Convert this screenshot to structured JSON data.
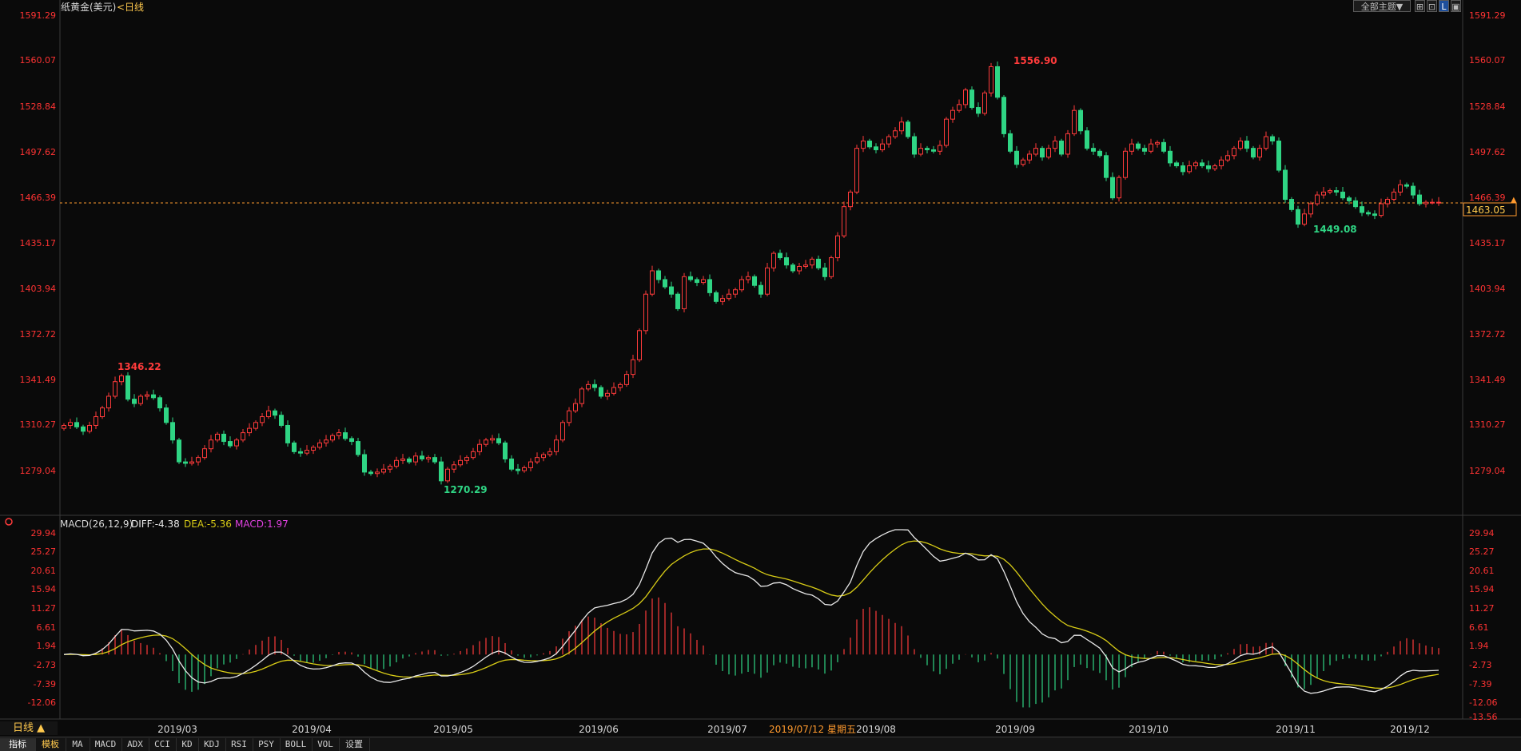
{
  "header": {
    "title": "纸黄金(美元)",
    "period": "<日线",
    "theme_button": "全部主题▼"
  },
  "price": {
    "current_label": "1463.05",
    "high_label": "1556.90",
    "low_label": "1270.29",
    "local_high_label": "1346.22",
    "recent_low_label": "1449.08"
  },
  "indicator": {
    "name": "MACD(26,12,9)",
    "diff_label": "DIFF:-4.38",
    "dea_label": "DEA:-5.36",
    "macd_label": "MACD:1.97"
  },
  "colors": {
    "up": "#ff3b3b",
    "down": "#2fd584",
    "axis_label": "#ff3333",
    "diff_line": "#e8e8e8",
    "dea_line": "#d8cc16",
    "macd_text": "#e040e0",
    "current_line": "#ff9a2e"
  },
  "xaxis": {
    "labels": [
      "2019/03",
      "2019/04",
      "2019/05",
      "2019/06",
      "2019/07",
      "2019/08",
      "2019/09",
      "2019/10",
      "2019/11",
      "2019/12"
    ],
    "cursor_date": "2019/07/12 星期五"
  },
  "bottom": {
    "period_tab": "日线 ▲",
    "tabs": [
      "指标",
      "模板",
      "MA",
      "MACD",
      "ADX",
      "CCI",
      "KD",
      "KDJ",
      "RSI",
      "PSY",
      "BOLL",
      "VOL",
      "设置"
    ]
  },
  "chart_data": [
    {
      "type": "candlestick",
      "title": "纸黄金(美元)",
      "y_ticks": [
        "1591.29",
        "1560.07",
        "1528.84",
        "1497.62",
        "1466.39",
        "1435.17",
        "1403.94",
        "1372.72",
        "1341.49",
        "1310.27",
        "1279.04"
      ],
      "ylim": [
        1261.0,
        1591.29
      ],
      "current_price": 1463.05,
      "high": {
        "value": 1556.9,
        "date": "2019/08"
      },
      "low": {
        "value": 1270.29,
        "date": "2019/05"
      },
      "close_series": [
        1310,
        1312,
        1309,
        1306,
        1310,
        1316,
        1322,
        1330,
        1340,
        1344,
        1328,
        1325,
        1330,
        1331,
        1329,
        1322,
        1312,
        1300,
        1285,
        1284,
        1285,
        1288,
        1294,
        1300,
        1304,
        1299,
        1296,
        1300,
        1305,
        1308,
        1312,
        1316,
        1320,
        1317,
        1310,
        1298,
        1292,
        1291,
        1293,
        1295,
        1298,
        1300,
        1303,
        1305,
        1301,
        1299,
        1290,
        1278,
        1277,
        1278,
        1280,
        1282,
        1286,
        1287,
        1285,
        1289,
        1287,
        1288,
        1285,
        1272,
        1280,
        1283,
        1286,
        1288,
        1292,
        1297,
        1300,
        1301,
        1298,
        1287,
        1280,
        1279,
        1281,
        1285,
        1288,
        1290,
        1292,
        1300,
        1312,
        1320,
        1325,
        1335,
        1338,
        1336,
        1330,
        1332,
        1336,
        1338,
        1345,
        1355,
        1375,
        1400,
        1416,
        1410,
        1405,
        1400,
        1390,
        1412,
        1410,
        1408,
        1410,
        1401,
        1395,
        1397,
        1400,
        1403,
        1410,
        1412,
        1406,
        1400,
        1418,
        1428,
        1425,
        1420,
        1416,
        1419,
        1420,
        1424,
        1418,
        1412,
        1425,
        1440,
        1460,
        1470,
        1500,
        1505,
        1501,
        1499,
        1503,
        1508,
        1512,
        1518,
        1508,
        1496,
        1500,
        1499,
        1498,
        1502,
        1520,
        1526,
        1530,
        1540,
        1528,
        1524,
        1538,
        1556,
        1535,
        1510,
        1498,
        1489,
        1492,
        1496,
        1500,
        1494,
        1500,
        1505,
        1496,
        1510,
        1526,
        1512,
        1500,
        1498,
        1495,
        1480,
        1466,
        1480,
        1498,
        1503,
        1500,
        1498,
        1503,
        1504,
        1498,
        1490,
        1488,
        1484,
        1488,
        1490,
        1488,
        1486,
        1488,
        1492,
        1495,
        1500,
        1505,
        1500,
        1494,
        1500,
        1508,
        1505,
        1485,
        1465,
        1458,
        1448,
        1455,
        1462,
        1468,
        1470,
        1471,
        1470,
        1466,
        1464,
        1460,
        1456,
        1455,
        1454,
        1462,
        1465,
        1470,
        1475,
        1474,
        1468,
        1462,
        1463,
        1463,
        1463
      ]
    },
    {
      "type": "bar",
      "title": "MACD(26,12,9)",
      "y_ticks": [
        "29.94",
        "25.27",
        "20.61",
        "15.94",
        "11.27",
        "6.61",
        "1.94",
        "-2.73",
        "-7.39",
        "-12.06",
        "-13.56"
      ],
      "ylim": [
        -13.56,
        29.94
      ],
      "series": [
        {
          "name": "DIFF",
          "last": -4.38
        },
        {
          "name": "DEA",
          "last": -5.36
        },
        {
          "name": "MACD",
          "last": 1.97
        }
      ]
    }
  ]
}
